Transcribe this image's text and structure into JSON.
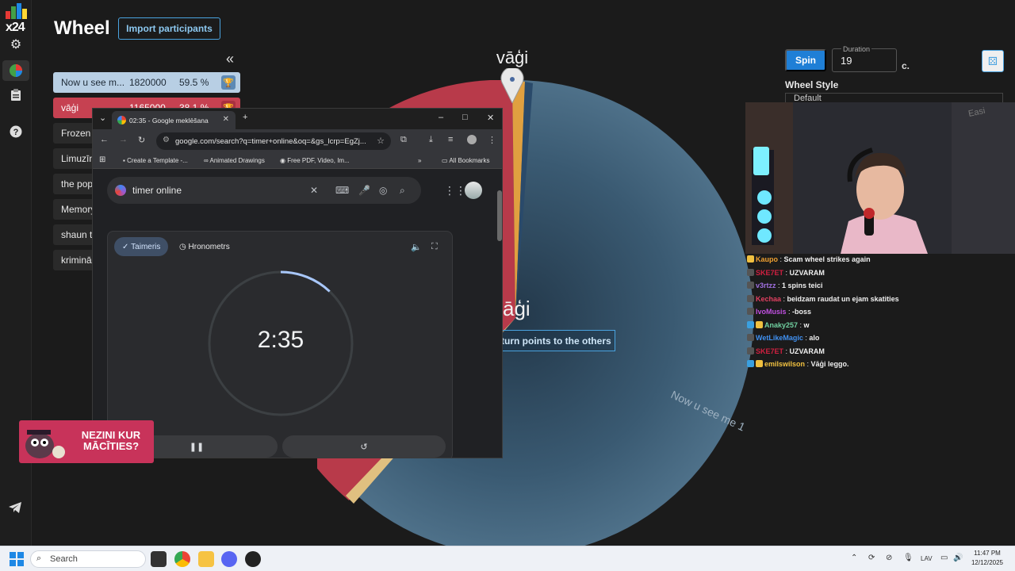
{
  "rail": {
    "logo_text": "x24",
    "icons": [
      "gear-icon",
      "pie-chart-icon",
      "clipboard-icon",
      "help-icon",
      "telegram-icon"
    ]
  },
  "header": {
    "title": "Wheel",
    "import_label": "Import participants",
    "collapse_glyph": "«"
  },
  "participants": [
    {
      "name": "Now u see m...",
      "value": "1820000",
      "percent": "59.5 %"
    },
    {
      "name": "vāģi",
      "value": "1165000",
      "percent": "38.1 %"
    },
    {
      "name": "Frozen",
      "value": "",
      "percent": ""
    },
    {
      "name": "Limuzīn",
      "value": "",
      "percent": ""
    },
    {
      "name": "the pop",
      "value": "",
      "percent": ""
    },
    {
      "name": "Memory",
      "value": "",
      "percent": ""
    },
    {
      "name": "shaun t",
      "value": "",
      "percent": ""
    },
    {
      "name": "krimināl",
      "value": "",
      "percent": ""
    }
  ],
  "wheel": {
    "winner_top": "vāģi",
    "center_winner": "āģi",
    "return_label": "eturn points to the others",
    "slice_label": "Now u see me 1",
    "colors": {
      "big": "#4a6a82",
      "red": "#b83a4a"
    }
  },
  "controls": {
    "spin_label": "Spin",
    "duration_label": "Duration",
    "duration_value": "19",
    "duration_unit": "c.",
    "wheel_style_label": "Wheel Style",
    "wheel_style_value": "Default"
  },
  "chat": [
    {
      "user": "Kaupo",
      "color": "#f0a030",
      "msg": "Scam wheel strikes again"
    },
    {
      "user": "SKE7ET",
      "color": "#d02040",
      "msg": "UZVARAM"
    },
    {
      "user": "v3rtzz",
      "color": "#a070e0",
      "msg": "1 spins teici"
    },
    {
      "user": "Kechaa",
      "color": "#e04060",
      "msg": "beidzam raudat un ejam skatities"
    },
    {
      "user": "IvoMusis",
      "color": "#c050e0",
      "msg": "-boss"
    },
    {
      "user": "Anaky257",
      "color": "#70d0a0",
      "msg": "w"
    },
    {
      "user": "WetLikeMagic",
      "color": "#4090f0",
      "msg": "alo"
    },
    {
      "user": "SKE7ET",
      "color": "#d02040",
      "msg": "UZVARAM"
    },
    {
      "user": "emilswilson",
      "color": "#f0c040",
      "msg": "Vāģi leggo."
    }
  ],
  "browser": {
    "tab_title": "02:35 - Google meklēšana",
    "url": "google.com/search?q=timer+online&oq=&gs_lcrp=EgZj...",
    "bookmarks": [
      "Create a Template -...",
      "Animated Drawings",
      "Free PDF, Video, Im...",
      "All Bookmarks"
    ],
    "query": "timer online",
    "timer_tab": "Taimeris",
    "stopwatch_tab": "Hronometrs",
    "time": "2:35",
    "progress": 0.12
  },
  "ad": {
    "line1": "NEZINI KUR",
    "line2": "MĀCĪTIES?"
  },
  "taskbar": {
    "search_placeholder": "Search",
    "lang": "LAV",
    "time": "11:47 PM",
    "date": "12/12/2025"
  }
}
